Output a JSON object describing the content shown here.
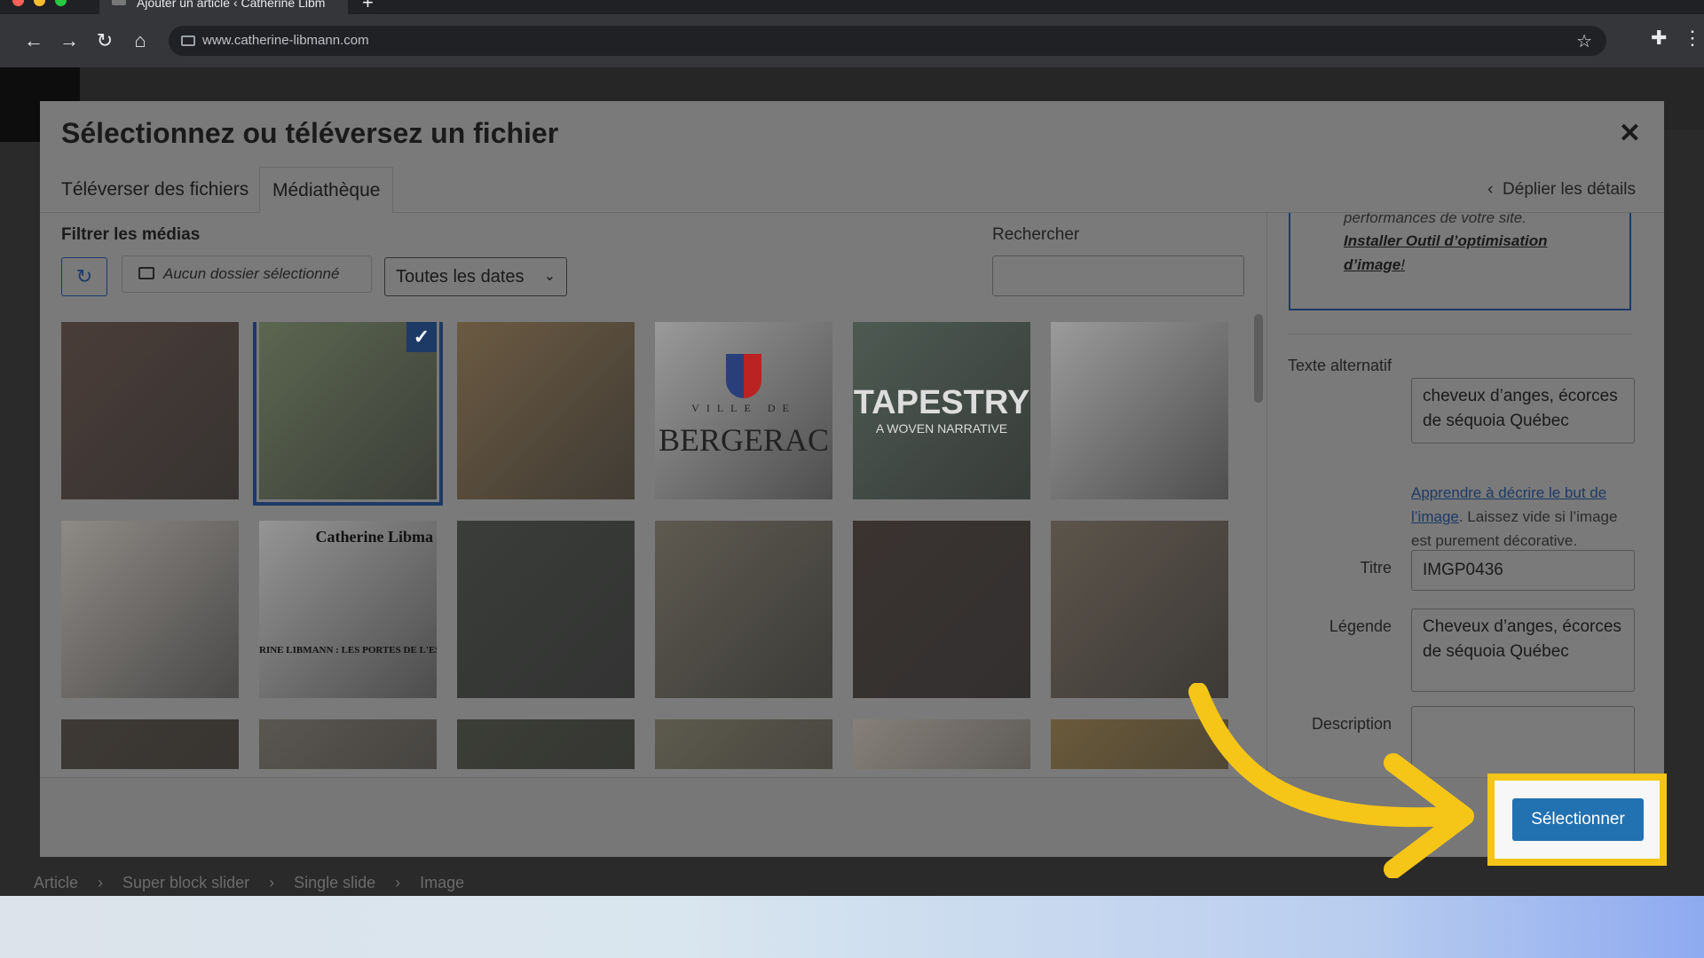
{
  "browser": {
    "tab_title": "Ajouter un article ‹ Catherine Libm",
    "url": "www.catherine-libmann.com",
    "accent": "#35363a"
  },
  "modal": {
    "title": "Sélectionnez ou téléversez un fichier",
    "tabs": [
      {
        "label": "Téléverser des fichiers"
      },
      {
        "label": "Médiathèque"
      }
    ],
    "details_toggle": "Déplier les détails",
    "filter_label": "Filtrer les médias",
    "folder_placeholder": "Aucun dossier sélectionné",
    "date_filter": "Toutes les dates",
    "search_label": "Rechercher",
    "search_value": ""
  },
  "media": [
    {
      "name": "thorny-branches",
      "selected": false,
      "color": "#4a3d38"
    },
    {
      "name": "angel-hair-sequoia",
      "selected": true,
      "color": "#5c6650"
    },
    {
      "name": "weaving-artist",
      "selected": false,
      "color": "#6b5a42"
    },
    {
      "name": "ville-de-bergerac",
      "selected": false,
      "color": "#9a9a9a",
      "caption": "BERGERAC",
      "small": "VILLE DE"
    },
    {
      "name": "tapestry-woven-narrative",
      "selected": false,
      "color": "#4d5a52",
      "caption": "TAPESTRY",
      "small": "A WOVEN NARRATIVE"
    },
    {
      "name": "text-document",
      "selected": false,
      "color": "#9b9b9b"
    },
    {
      "name": "woven-sphere",
      "selected": false,
      "color": "#8e8a86"
    },
    {
      "name": "catherine-libmann-article",
      "selected": false,
      "color": "#959595",
      "caption": "Catherine Libma",
      "small": "RINE LIBMANN : LES PORTES DE L'ESPA"
    },
    {
      "name": "fiber-tapestry",
      "selected": false,
      "color": "#3a3d3a"
    },
    {
      "name": "bark-texture-green",
      "selected": false,
      "color": "#5e5a50"
    },
    {
      "name": "wooden-sculptures",
      "selected": false,
      "color": "#3a3330"
    },
    {
      "name": "stone-texture",
      "selected": false,
      "color": "#5d554b"
    },
    {
      "name": "sculpture-interior",
      "selected": false,
      "color": "#3e3934"
    },
    {
      "name": "loom-threads",
      "selected": false,
      "color": "#5a5650"
    },
    {
      "name": "dark-branches",
      "selected": false,
      "color": "#3b3d36"
    },
    {
      "name": "dry-twigs",
      "selected": false,
      "color": "#5d5a4d"
    },
    {
      "name": "gallery-wall",
      "selected": false,
      "color": "#868079"
    },
    {
      "name": "golden-fibers",
      "selected": false,
      "color": "#6a5a3a"
    }
  ],
  "details": {
    "notice_text": "performances de votre site.",
    "notice_link": "Installer Outil d’optimisation d’image",
    "notice_suffix": "!",
    "alt_label": "Texte alternatif",
    "alt_value": "cheveux d’anges, écorces de séquoia Québec",
    "alt_help_link": "Apprendre à décrire le but de l’image",
    "alt_help_text": ". Laissez vide si l’image est purement décorative.",
    "title_label": "Titre",
    "title_value": "IMGP0436",
    "caption_label": "Légende",
    "caption_value": "Cheveux d’anges, écorces de séquoia  Québec",
    "description_label": "Description",
    "description_value": ""
  },
  "footer": {
    "select_button": "Sélectionner",
    "highlight_color": "#f5c518",
    "button_color": "#2271b1"
  },
  "breadcrumb": [
    "Article",
    "Super block slider",
    "Single slide",
    "Image"
  ]
}
